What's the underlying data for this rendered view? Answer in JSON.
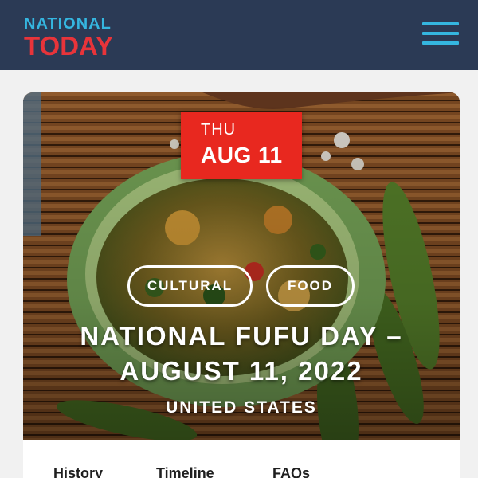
{
  "header": {
    "logo_top": "NATIONAL",
    "logo_bottom": "TODAY",
    "menu_icon": "hamburger-menu-icon",
    "background_color": "#2b3a55",
    "accent_blue": "#35b6e0",
    "accent_red": "#e8343a"
  },
  "hero": {
    "date": {
      "day_of_week": "THU",
      "date": "AUG 11",
      "color": "#e8281f"
    },
    "tags": [
      "CULTURAL",
      "FOOD"
    ],
    "title_line1": "NATIONAL FUFU DAY –",
    "title_line2": "AUGUST 11, 2022",
    "country": "UNITED STATES"
  },
  "tabs": [
    {
      "label": "History"
    },
    {
      "label": "Timeline"
    },
    {
      "label": "FAQs"
    }
  ]
}
